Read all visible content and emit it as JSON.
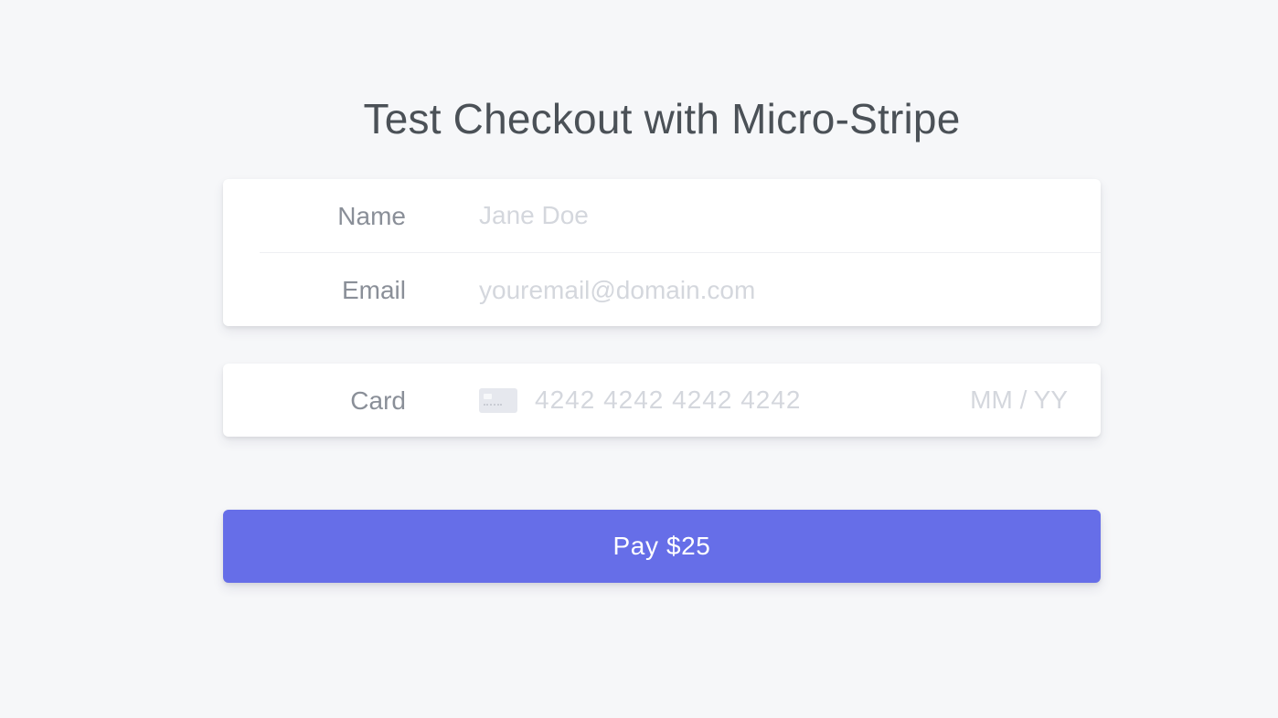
{
  "page": {
    "title": "Test Checkout with Micro-Stripe"
  },
  "details": {
    "name": {
      "label": "Name",
      "placeholder": "Jane Doe",
      "value": ""
    },
    "email": {
      "label": "Email",
      "placeholder": "youremail@domain.com",
      "value": ""
    }
  },
  "payment": {
    "label": "Card",
    "icon": "credit-card-icon",
    "card_number_placeholder": "4242 4242 4242 4242",
    "expiry_placeholder": "MM / YY"
  },
  "pay_button": {
    "label": "Pay $25"
  },
  "colors": {
    "background": "#f6f7f9",
    "accent": "#666ee8",
    "label_text": "#8a8f98",
    "placeholder_text": "#d4d7dd",
    "title_text": "#4b5157"
  }
}
